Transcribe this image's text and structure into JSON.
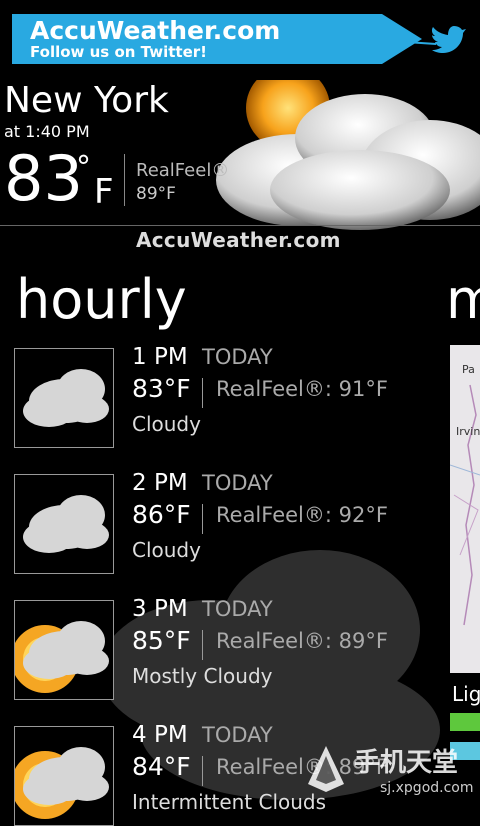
{
  "banner": {
    "title": "AccuWeather.com",
    "subtitle": "Follow us on Twitter!",
    "icon": "twitter-bird-icon",
    "color": "#29a9e1"
  },
  "current": {
    "city": "New York",
    "time": "at 1:40 PM",
    "temp": "83",
    "deg": "°",
    "unit": "F",
    "realfeel_label": "RealFeel®",
    "realfeel_value": "89°F",
    "brand": "AccuWeather.com",
    "icon": "sun-cloud-icon"
  },
  "hourly": {
    "title": "hourly",
    "next_title": "m",
    "rows": [
      {
        "time": "1 PM",
        "day": "TODAY",
        "temp": "83°F",
        "realfeel": "RealFeel®: 91°F",
        "condition": "Cloudy",
        "icon": "cloud-icon"
      },
      {
        "time": "2 PM",
        "day": "TODAY",
        "temp": "86°F",
        "realfeel": "RealFeel®: 92°F",
        "condition": "Cloudy",
        "icon": "cloud-icon"
      },
      {
        "time": "3 PM",
        "day": "TODAY",
        "temp": "85°F",
        "realfeel": "RealFeel®: 89°F",
        "condition": "Mostly Cloudy",
        "icon": "sun-cloud-icon"
      },
      {
        "time": "4 PM",
        "day": "TODAY",
        "temp": "84°F",
        "realfeel": "RealFeel®: 89°F",
        "condition": "Intermittent Clouds",
        "icon": "sun-cloud-icon"
      }
    ]
  },
  "map": {
    "labels": [
      "Pa",
      "Irvin"
    ],
    "legend_label": "Lig"
  },
  "watermark": {
    "text": "手机天堂",
    "url": "sj.xpgod.com"
  }
}
